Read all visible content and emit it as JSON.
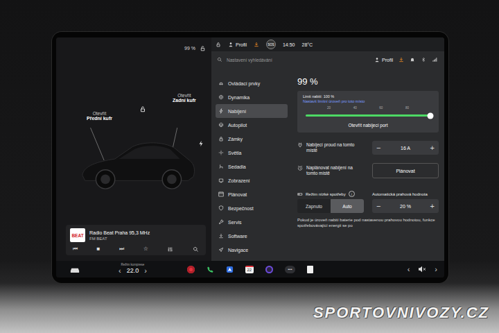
{
  "left_pane": {
    "battery": "99 %",
    "frunk": {
      "action": "Otevřít",
      "label": "Přední kufr"
    },
    "trunk": {
      "action": "Otevřít",
      "label": "Zadní kufr"
    }
  },
  "media": {
    "logo": "BEAT",
    "station": "Radio Beat Praha 95,3 MHz",
    "source": "FM BEAT",
    "controls": [
      "⏮",
      "■",
      "⏭",
      "☆"
    ]
  },
  "dock": {
    "climate_label": "Režim komprese",
    "temperature": "22.0",
    "temp_down": "‹",
    "temp_up": "›",
    "calendar_day": "22",
    "more": "•••",
    "volume_prev": "‹",
    "volume_next": "›"
  },
  "status_bar": {
    "profile": "Profil",
    "sos": "SOS",
    "time": "14:50",
    "temperature": "28°C"
  },
  "search": {
    "placeholder": "Nastavení vyhledávání",
    "profile": "Profil"
  },
  "menu": [
    {
      "label": "Ovládací prvky",
      "selected": false
    },
    {
      "label": "Dynamika",
      "selected": false
    },
    {
      "label": "Nabíjení",
      "selected": true
    },
    {
      "label": "Autopilot",
      "selected": false
    },
    {
      "label": "Zámky",
      "selected": false
    },
    {
      "label": "Světla",
      "selected": false
    },
    {
      "label": "Sedadla",
      "selected": false
    },
    {
      "label": "Zobrazení",
      "selected": false
    },
    {
      "label": "Plánovat",
      "selected": false
    },
    {
      "label": "Bezpečnost",
      "selected": false
    },
    {
      "label": "Servis",
      "selected": false
    },
    {
      "label": "Software",
      "selected": false
    },
    {
      "label": "Navigace",
      "selected": false
    }
  ],
  "charging": {
    "level_text": "99 %",
    "limit": {
      "title": "Limit nabití: 100 %",
      "subtitle": "Nastavit limitní úroveň pro toto místo",
      "ticks": [
        "20",
        "40",
        "60",
        "80"
      ],
      "level": 1.0
    },
    "port_button": "Otevřít nabíjecí port",
    "current": {
      "label": "Nabíjecí proud na tomto místě",
      "minus": "−",
      "value": "16 A",
      "plus": "+"
    },
    "schedule": {
      "label": "Naplánovat nabíjení na tomto místě",
      "button": "Plánovat"
    },
    "low_power": {
      "label": "Režim nízké spotřeby",
      "info": "i",
      "options": [
        {
          "label": "Zapnuto",
          "selected": false
        },
        {
          "label": "Auto",
          "selected": true
        }
      ]
    },
    "threshold": {
      "label": "Automatická prahová hodnota",
      "minus": "−",
      "value": "20 %",
      "plus": "+"
    },
    "note": "Pokud je úroveň nabití baterie pod nastavenou prahovou hodnotou, funkce spotřebovávající energii se po"
  },
  "watermark": "SPORTOVNIVOZY.CZ"
}
